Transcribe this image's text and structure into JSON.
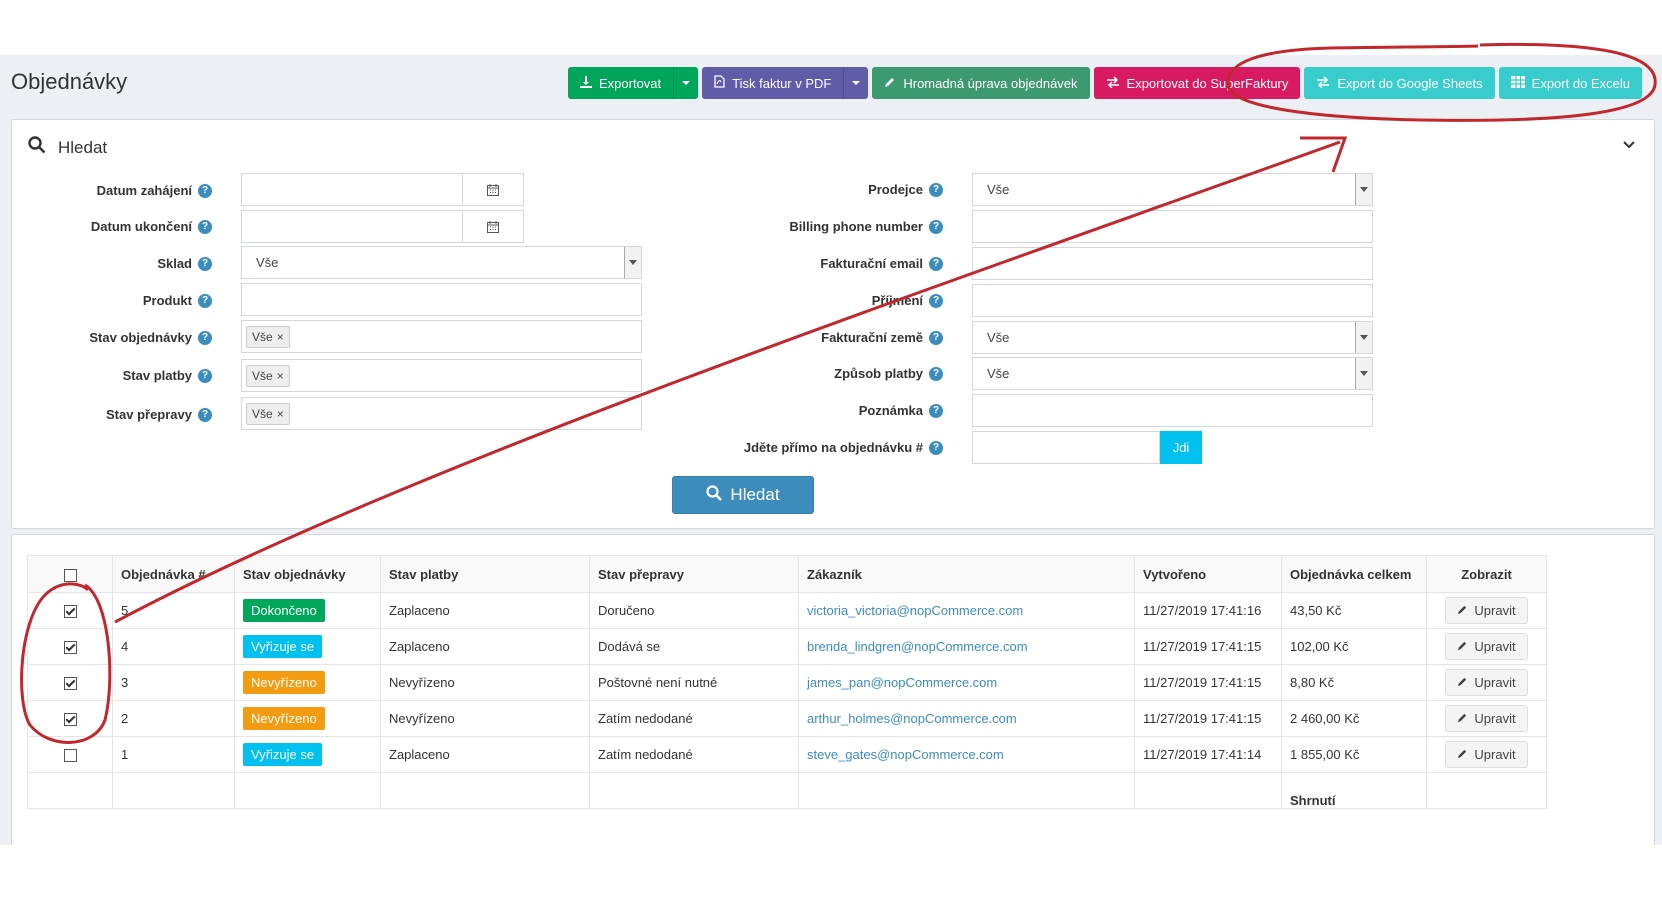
{
  "page": {
    "title": "Objednávky"
  },
  "toolbar": {
    "export": "Exportovat",
    "print_pdf": "Tisk faktur v PDF",
    "bulk_edit": "Hromadná úprava objednávek",
    "export_superfaktura": "Exportovat do SuperFaktury",
    "export_google_sheets": "Export do Google Sheets",
    "export_excel": "Export do Excelu"
  },
  "search": {
    "title": "Hledat",
    "left_fields": [
      {
        "label": "Datum zahájení",
        "value": ""
      },
      {
        "label": "Datum ukončení",
        "value": ""
      },
      {
        "label": "Sklad",
        "value": "Vše"
      },
      {
        "label": "Produkt",
        "value": ""
      },
      {
        "label": "Stav objednávky",
        "value": "Vše"
      },
      {
        "label": "Stav platby",
        "value": "Vše"
      },
      {
        "label": "Stav přepravy",
        "value": "Vše"
      }
    ],
    "right_fields": [
      {
        "label": "Prodejce",
        "value": "Vše"
      },
      {
        "label": "Billing phone number",
        "value": ""
      },
      {
        "label": "Fakturační email",
        "value": ""
      },
      {
        "label": "Příjmení",
        "value": ""
      },
      {
        "label": "Fakturační země",
        "value": "Vše"
      },
      {
        "label": "Způsob platby",
        "value": "Vše"
      },
      {
        "label": "Poznámka",
        "value": ""
      },
      {
        "label": "Jděte přímo na objednávku #",
        "value": ""
      }
    ],
    "go_label": "Jdi",
    "submit_label": "Hledat"
  },
  "orders": {
    "columns": [
      "Objednávka #",
      "Stav objednávky",
      "Stav platby",
      "Stav přepravy",
      "Zákazník",
      "Vytvořeno",
      "Objednávka celkem",
      "Zobrazit"
    ],
    "rows": [
      {
        "checked": true,
        "id": "5",
        "status": "Dokončeno",
        "status_color": "#00a65a",
        "payment": "Zaplaceno",
        "shipping": "Doručeno",
        "customer": "victoria_victoria@nopCommerce.com",
        "created": "11/27/2019 17:41:16",
        "total": "43,50 Kč"
      },
      {
        "checked": true,
        "id": "4",
        "status": "Vyřizuje se",
        "status_color": "#00c0ef",
        "payment": "Zaplaceno",
        "shipping": "Dodává se",
        "customer": "brenda_lindgren@nopCommerce.com",
        "created": "11/27/2019 17:41:15",
        "total": "102,00 Kč"
      },
      {
        "checked": true,
        "id": "3",
        "status": "Nevyřízeno",
        "status_color": "#f39c12",
        "payment": "Nevyřízeno",
        "shipping": "Poštovné není nutné",
        "customer": "james_pan@nopCommerce.com",
        "created": "11/27/2019 17:41:15",
        "total": "8,80 Kč"
      },
      {
        "checked": true,
        "id": "2",
        "status": "Nevyřízeno",
        "status_color": "#f39c12",
        "payment": "Nevyřízeno",
        "shipping": "Zatím nedodané",
        "customer": "arthur_holmes@nopCommerce.com",
        "created": "11/27/2019 17:41:15",
        "total": "2 460,00 Kč"
      },
      {
        "checked": false,
        "id": "1",
        "status": "Vyřizuje se",
        "status_color": "#00c0ef",
        "payment": "Zaplaceno",
        "shipping": "Zatím nedodané",
        "customer": "steve_gates@nopCommerce.com",
        "created": "11/27/2019 17:41:14",
        "total": "1 855,00 Kč"
      }
    ],
    "edit_label": "Upravit",
    "summary_label": "Shrnutí"
  },
  "colors": {
    "annotation": "#c0282d",
    "primary": "#3c8dbc"
  }
}
